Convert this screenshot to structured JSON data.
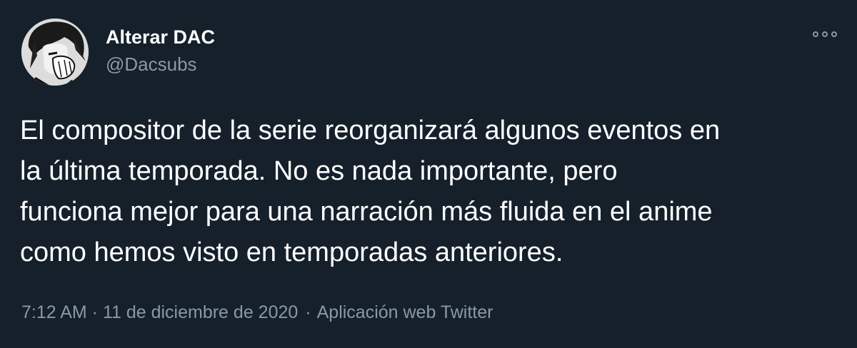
{
  "author": {
    "display_name": "Alterar DAC",
    "handle": "@Dacsubs",
    "avatar_icon": "profile-avatar"
  },
  "more_icon": "more-options-icon",
  "tweet": {
    "lines": [
      "El compositor de la serie reorganizará algunos eventos en",
      "la última temporada. No es nada importante, pero",
      "funciona mejor para una narración más fluida en el anime",
      "como hemos visto en temporadas anteriores."
    ]
  },
  "meta": {
    "timestamp": "7:12 AM · 11 de diciembre de 2020",
    "separator": "·",
    "source": "Aplicación web Twitter"
  },
  "colors": {
    "background": "#15202b",
    "text": "#ffffff",
    "muted": "#8899a6"
  }
}
